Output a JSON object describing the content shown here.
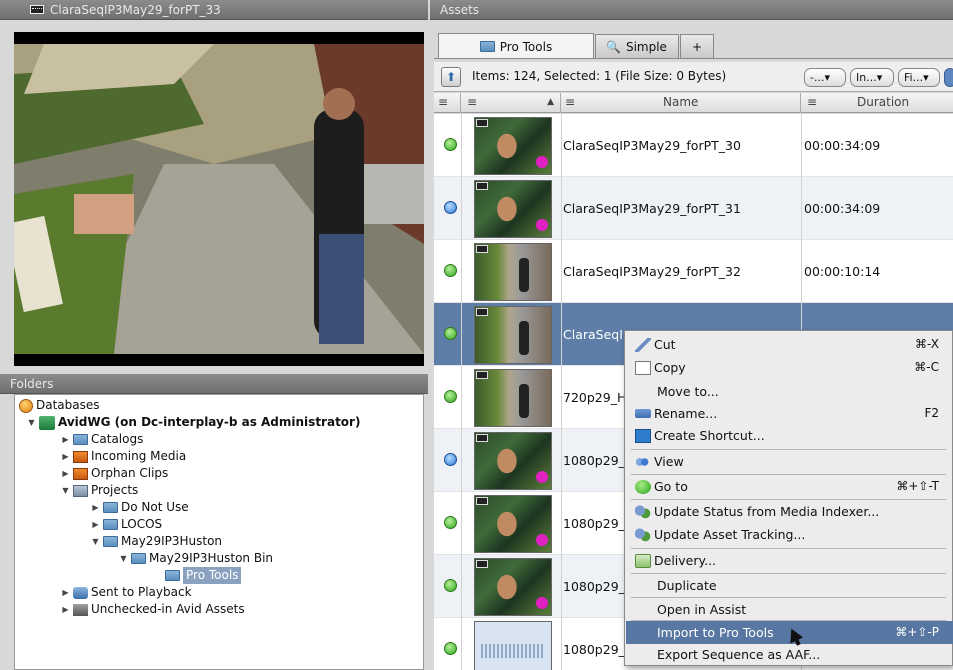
{
  "viewer": {
    "title": "ClaraSeqIP3May29_forPT_33"
  },
  "folders": {
    "title": "Folders",
    "tree": [
      {
        "label": "Databases",
        "icon": "database-icon"
      },
      {
        "label": "AvidWG (on Dc-interplay-b as Administrator)",
        "icon": "workgroup-icon"
      },
      {
        "label": "Catalogs",
        "icon": "folder-icon"
      },
      {
        "label": "Incoming Media",
        "icon": "incoming-media-icon"
      },
      {
        "label": "Orphan Clips",
        "icon": "orphan-clips-icon"
      },
      {
        "label": "Projects",
        "icon": "projects-icon"
      },
      {
        "label": "Do Not Use",
        "icon": "folder-icon"
      },
      {
        "label": "LOCOS",
        "icon": "folder-icon"
      },
      {
        "label": "May29IP3Huston",
        "icon": "folder-icon"
      },
      {
        "label": "May29IP3Huston Bin",
        "icon": "folder-icon"
      },
      {
        "label": "Pro Tools",
        "icon": "folder-icon"
      },
      {
        "label": "Sent to Playback",
        "icon": "send-icon"
      },
      {
        "label": "Unchecked-in Avid Assets",
        "icon": "unchecked-icon"
      }
    ]
  },
  "assets": {
    "title": "Assets",
    "tabs": [
      {
        "label": "Pro Tools",
        "icon": "folder-icon"
      },
      {
        "label": "Simple",
        "icon": "search-icon"
      },
      {
        "label": "+",
        "icon": ""
      }
    ],
    "items_summary": "Items: 124, Selected: 1 (File Size: 0 Bytes)",
    "filters": [
      "-...",
      "In...",
      "Fi..."
    ],
    "columns": {
      "name": "Name",
      "duration": "Duration"
    },
    "rows": [
      {
        "name": "ClaraSeqIP3May29_forPT_30",
        "duration": "00:00:34:09",
        "status": "green",
        "thumb": "face"
      },
      {
        "name": "ClaraSeqIP3May29_forPT_31",
        "duration": "00:00:34:09",
        "status": "blue",
        "thumb": "face"
      },
      {
        "name": "ClaraSeqIP3May29_forPT_32",
        "duration": "00:00:10:14",
        "status": "green",
        "thumb": "street"
      },
      {
        "name": "ClaraSeqIP",
        "duration": "",
        "status": "green",
        "thumb": "street"
      },
      {
        "name": "720p29_H",
        "duration": "",
        "status": "green",
        "thumb": "street"
      },
      {
        "name": "1080p29_",
        "duration": "",
        "status": "blue",
        "thumb": "face"
      },
      {
        "name": "1080p29_",
        "duration": "",
        "status": "green",
        "thumb": "face"
      },
      {
        "name": "1080p29_",
        "duration": "",
        "status": "green",
        "thumb": "face"
      },
      {
        "name": "1080p29_",
        "duration": "",
        "status": "green",
        "thumb": "audio"
      }
    ]
  },
  "context_menu": {
    "items": [
      {
        "label": "Cut",
        "shortcut": "⌘-X",
        "icon": "cut-icon"
      },
      {
        "label": "Copy",
        "shortcut": "⌘-C",
        "icon": "copy-icon"
      },
      {
        "label": "Move to...",
        "shortcut": "",
        "icon": ""
      },
      {
        "label": "Rename...",
        "shortcut": "F2",
        "icon": "rename-icon"
      },
      {
        "label": "Create Shortcut...",
        "shortcut": "",
        "icon": "shortcut-icon"
      },
      {
        "label": "View",
        "shortcut": "",
        "icon": "view-icon"
      },
      {
        "label": "Go to",
        "shortcut": "⌘+⇧-T",
        "icon": "goto-icon"
      },
      {
        "label": "Update Status from Media Indexer...",
        "shortcut": "",
        "icon": "puzzle-icon"
      },
      {
        "label": "Update Asset Tracking...",
        "shortcut": "",
        "icon": "puzzle-icon"
      },
      {
        "label": "Delivery...",
        "shortcut": "",
        "icon": "delivery-icon"
      },
      {
        "label": "Duplicate",
        "shortcut": "",
        "icon": ""
      },
      {
        "label": "Open in Assist",
        "shortcut": "",
        "icon": ""
      },
      {
        "label": "Import to Pro Tools",
        "shortcut": "⌘+⇧-P",
        "icon": ""
      },
      {
        "label": "Export Sequence as AAF...",
        "shortcut": "",
        "icon": ""
      }
    ]
  }
}
